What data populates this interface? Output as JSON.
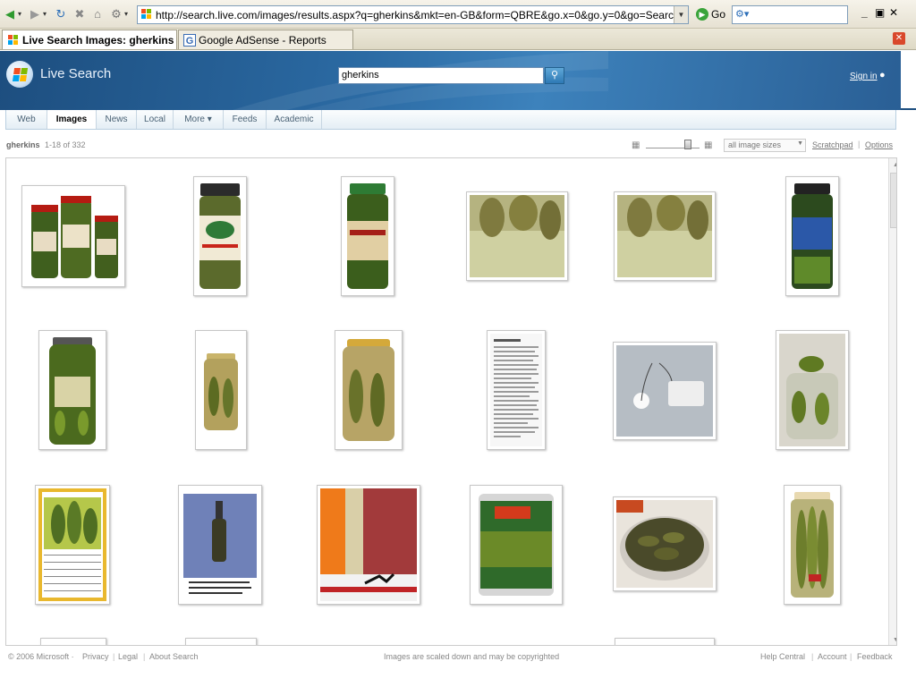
{
  "browser": {
    "address": "http://search.live.com/images/results.aspx?q=gherkins&mkt=en-GB&form=QBRE&go.x=0&go.y=0&go=Search",
    "go_label": "Go",
    "tabs": [
      {
        "label": "Live Search Images: gherkins"
      },
      {
        "label": "Google AdSense - Reports"
      }
    ]
  },
  "header": {
    "brand": "Live Search",
    "query": "gherkins",
    "signin": "Sign in"
  },
  "scopes": [
    "Web",
    "Images",
    "News",
    "Local",
    "More ▾",
    "Feeds",
    "Academic"
  ],
  "results": {
    "query": "gherkins",
    "count": "1-18 of 332",
    "size_filter": "all image sizes",
    "scratchpad": "Scratchpad",
    "separator": "|",
    "options": "Options"
  },
  "footer": {
    "copyright": "© 2006 Microsoft ·",
    "privacy": "Privacy",
    "legal": "Legal",
    "about": "About Search",
    "separator": "|",
    "notice": "Images are scaled down and may be copyrighted",
    "help": "Help Central",
    "account": "Account",
    "feedback": "Feedback"
  },
  "colors": {
    "header_blue": "#1d4e7f",
    "link_gray": "#777777",
    "pickle_green": "#4f6e22"
  }
}
